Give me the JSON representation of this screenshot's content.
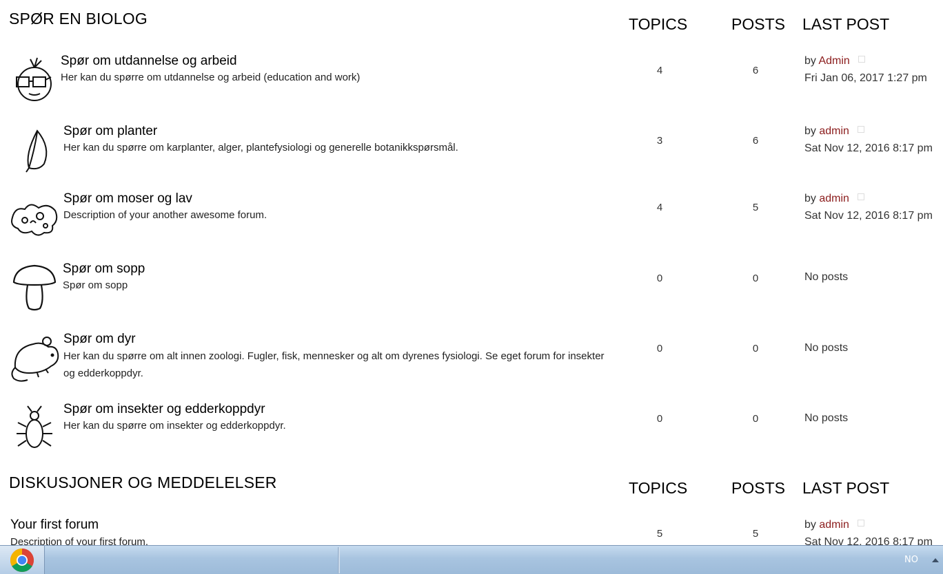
{
  "categories": [
    {
      "title": "SPØR EN BIOLOG",
      "col_topics": "TOPICS",
      "col_posts": "POSTS",
      "col_last_post": "LAST POST",
      "forums": [
        {
          "icon": "glasses-face-icon",
          "title": "Spør om utdannelse og arbeid",
          "desc": "Her kan du spørre om utdannelse og arbeid (education and work)",
          "topics": "4",
          "posts": "6",
          "lp_by": "by",
          "lp_user": "Admin",
          "lp_date": "Fri Jan 06, 2017 1:27 pm"
        },
        {
          "icon": "leaf-icon",
          "title": "Spør om planter",
          "desc": "Her kan du spørre om karplanter, alger, plantefysiologi og generelle botanikkspørsmål.",
          "topics": "3",
          "posts": "6",
          "lp_by": "by",
          "lp_user": "admin",
          "lp_date": "Sat Nov 12, 2016 8:17 pm"
        },
        {
          "icon": "lichen-icon",
          "title": "Spør om moser og lav",
          "desc": "Description of your another awesome forum.",
          "topics": "4",
          "posts": "5",
          "lp_by": "by",
          "lp_user": "admin",
          "lp_date": "Sat Nov 12, 2016 8:17 pm"
        },
        {
          "icon": "mushroom-icon",
          "title": "Spør om sopp",
          "desc": "Spør om sopp",
          "topics": "0",
          "posts": "0",
          "lp_none": "No posts"
        },
        {
          "icon": "mouse-icon",
          "title": "Spør om dyr",
          "desc": "Her kan du spørre om alt innen zoologi. Fugler, fisk, mennesker og alt om dyrenes fysiologi. Se eget forum for insekter og edderkoppdyr.",
          "topics": "0",
          "posts": "0",
          "lp_none": "No posts"
        },
        {
          "icon": "insect-icon",
          "title": "Spør om insekter og edderkoppdyr",
          "desc": "Her kan du spørre om insekter og edderkoppdyr.",
          "topics": "0",
          "posts": "0",
          "lp_none": "No posts"
        }
      ]
    },
    {
      "title": "DISKUSJONER OG MEDDELELSER",
      "col_topics": "TOPICS",
      "col_posts": "POSTS",
      "col_last_post": "LAST POST",
      "forums": [
        {
          "title": "Your first forum",
          "desc": "Description of your first forum.",
          "topics": "5",
          "posts": "5",
          "lp_by": "by",
          "lp_user": "admin",
          "lp_date": "Sat Nov 12, 2016 8:17 pm"
        }
      ]
    }
  ],
  "taskbar": {
    "start_icon": "chrome-icon",
    "language": "NO",
    "tray_icon": "show-hidden-icons-arrow"
  },
  "colors": {
    "username": "#8b1c1c",
    "taskbar": "#a8c4e0"
  }
}
